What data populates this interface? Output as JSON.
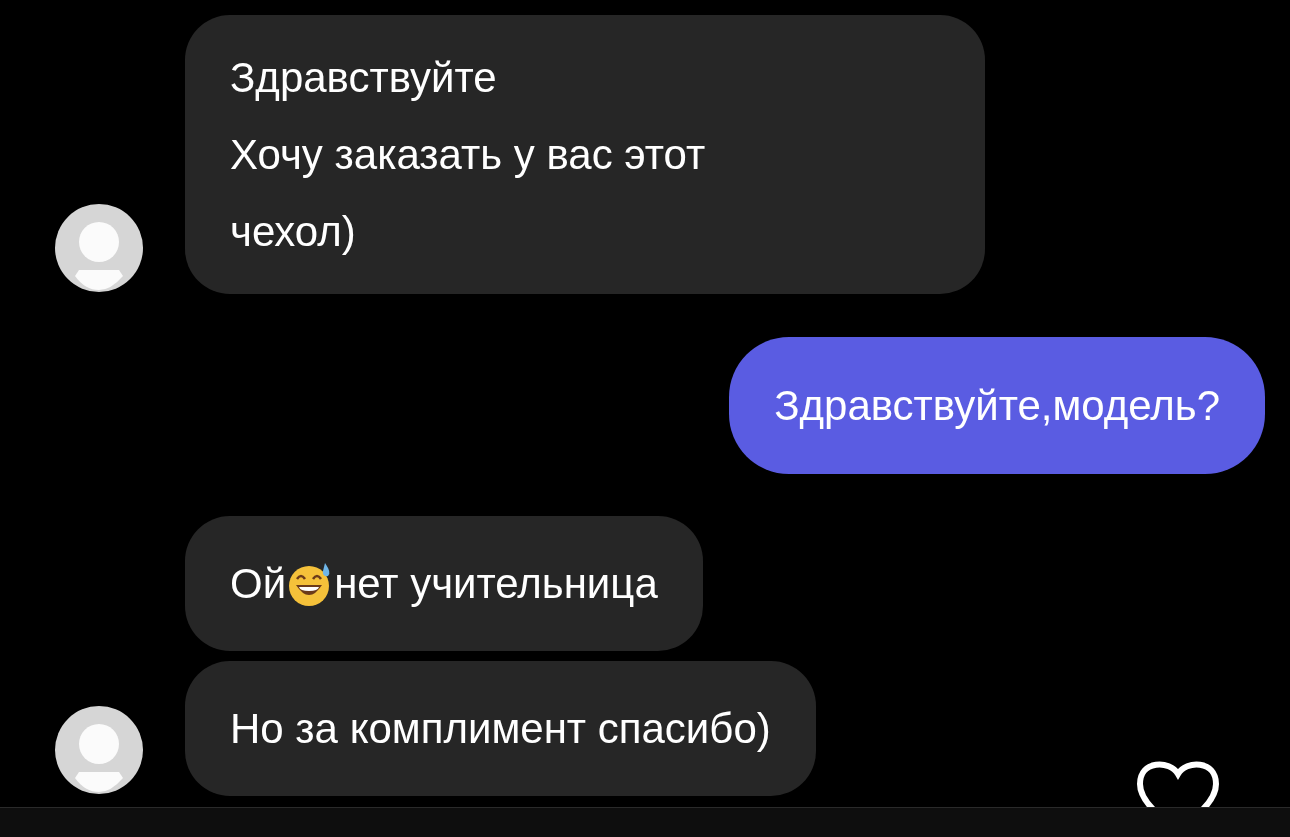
{
  "messages": [
    {
      "kind": "received",
      "avatar": true,
      "segments": [
        {
          "kind": "text",
          "text": "Здравствуйте"
        },
        {
          "kind": "break"
        },
        {
          "kind": "text",
          "text": "Хочу заказать у вас этот"
        },
        {
          "kind": "break"
        },
        {
          "kind": "text",
          "text": "чехол)"
        }
      ]
    },
    {
      "kind": "sent",
      "avatar": false,
      "segments": [
        {
          "kind": "text",
          "text": "Здравствуйте,модель?"
        }
      ]
    },
    {
      "kind": "received",
      "avatar": false,
      "segments": [
        {
          "kind": "text",
          "text": "Ой"
        },
        {
          "kind": "emoji"
        },
        {
          "kind": "text",
          "text": "нет учительница"
        }
      ]
    },
    {
      "kind": "received",
      "avatar": true,
      "segments": [
        {
          "kind": "text",
          "text": "Но за комплимент спасибо)"
        }
      ]
    }
  ],
  "liked": false
}
